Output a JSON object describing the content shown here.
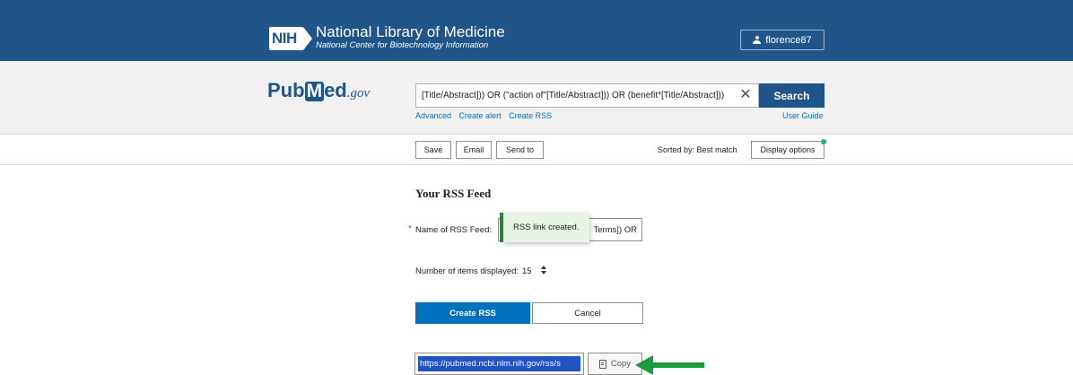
{
  "header": {
    "logo_text": "NIH",
    "title": "National Library of Medicine",
    "subtitle": "National Center for Biotechnology Information",
    "user": "florence87"
  },
  "search": {
    "logo_pub": "Pub",
    "logo_m": "M",
    "logo_ed": "ed",
    "logo_gov": ".gov",
    "query": "[Title/Abstract])) OR (\"action of\"[Title/Abstract])) OR (benefit*[Title/Abstract]))",
    "button": "Search",
    "links": [
      "Advanced",
      "Create alert",
      "Create RSS"
    ],
    "user_guide": "User Guide"
  },
  "actions": {
    "save": "Save",
    "email": "Email",
    "send_to": "Send to",
    "sorted_by": "Sorted by: Best match",
    "display_options": "Display options"
  },
  "rss": {
    "title": "Your RSS Feed",
    "required_mark": "*",
    "name_label": "Name of RSS Feed:",
    "name_value": "Terms]) OR",
    "toast": "RSS link created.",
    "items_label": "Number of items displayed:",
    "items_value": "15",
    "create_button": "Create RSS",
    "cancel_button": "Cancel",
    "url": "https://pubmed.ncbi.nlm.nih.gov/rss/s",
    "copy_button": "Copy"
  },
  "colors": {
    "nih_blue": "#20558a",
    "link_blue": "#0071bc",
    "toast_green": "#2e8540",
    "arrow_green": "#1a9c3e",
    "selection_blue": "#1f53c6"
  }
}
